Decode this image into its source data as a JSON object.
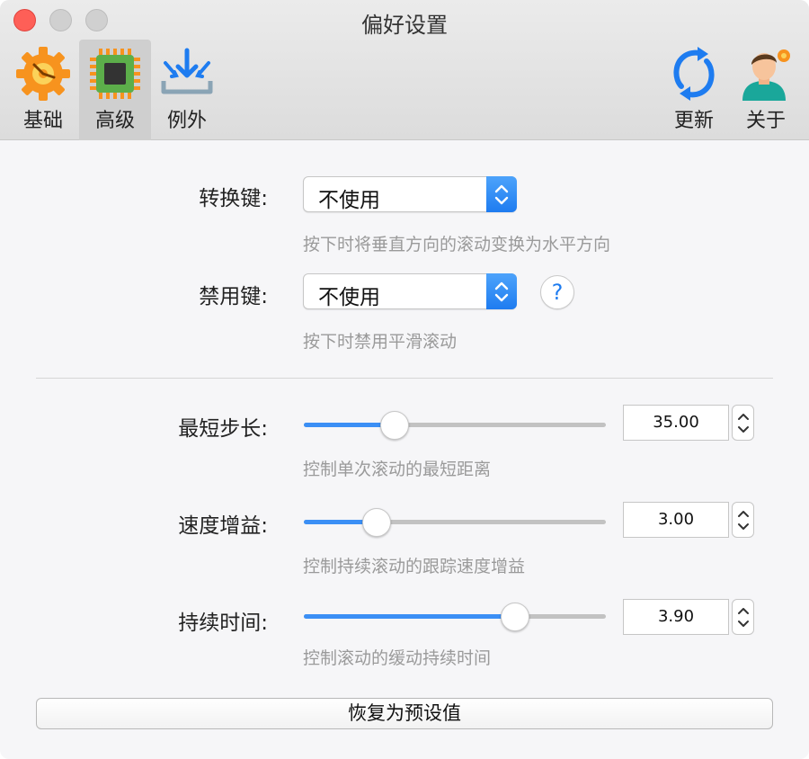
{
  "window": {
    "title": "偏好设置"
  },
  "toolbar": {
    "items": [
      {
        "label": "基础",
        "icon": "gear-icon"
      },
      {
        "label": "高级",
        "icon": "chip-icon",
        "selected": true
      },
      {
        "label": "例外",
        "icon": "download-tray-icon"
      },
      {
        "label": "更新",
        "icon": "refresh-icon"
      },
      {
        "label": "关于",
        "icon": "user-avatar-icon"
      }
    ]
  },
  "modifier": {
    "label": "转换键:",
    "value": "不使用",
    "hint": "按下时将垂直方向的滚动变换为水平方向"
  },
  "disable": {
    "label": "禁用键:",
    "value": "不使用",
    "help": "?",
    "hint": "按下时禁用平滑滚动"
  },
  "sliders": [
    {
      "label": "最短步长:",
      "value": "35.00",
      "level": 0.3,
      "hint": "控制单次滚动的最短距离"
    },
    {
      "label": "速度增益:",
      "value": "3.00",
      "level": 0.24,
      "hint": "控制持续滚动的跟踪速度增益"
    },
    {
      "label": "持续时间:",
      "value": "3.90",
      "level": 0.7,
      "hint": "控制滚动的缓动持续时间"
    }
  ],
  "reset_label": "恢复为预设值",
  "colors": {
    "accent": "#1e7cf0",
    "close": "#fe5f57",
    "hint": "#9a9a9a"
  }
}
